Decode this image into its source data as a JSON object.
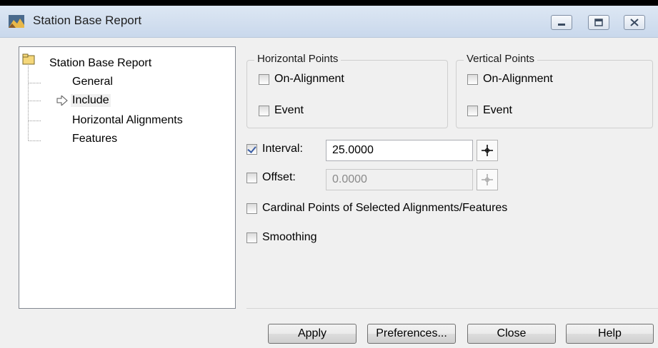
{
  "window": {
    "title": "Station Base Report"
  },
  "tree": {
    "root": "Station Base Report",
    "items": [
      {
        "label": "General"
      },
      {
        "label": "Include"
      },
      {
        "label": "Horizontal Alignments"
      },
      {
        "label": "Features"
      }
    ],
    "selected_index": 1
  },
  "horizontal_points": {
    "title": "Horizontal Points",
    "on_alignment": {
      "label": "On-Alignment",
      "checked": false
    },
    "event": {
      "label": "Event",
      "checked": false
    }
  },
  "vertical_points": {
    "title": "Vertical Points",
    "on_alignment": {
      "label": "On-Alignment",
      "checked": false
    },
    "event": {
      "label": "Event",
      "checked": false
    }
  },
  "interval": {
    "label": "Interval:",
    "checked": true,
    "value": "25.0000"
  },
  "offset": {
    "label": "Offset:",
    "checked": false,
    "value": "0.0000"
  },
  "cardinal": {
    "label": "Cardinal Points of Selected Alignments/Features",
    "checked": false
  },
  "smoothing": {
    "label": "Smoothing",
    "checked": false
  },
  "buttons": {
    "apply": "Apply",
    "preferences": "Preferences...",
    "close": "Close",
    "help": "Help"
  }
}
